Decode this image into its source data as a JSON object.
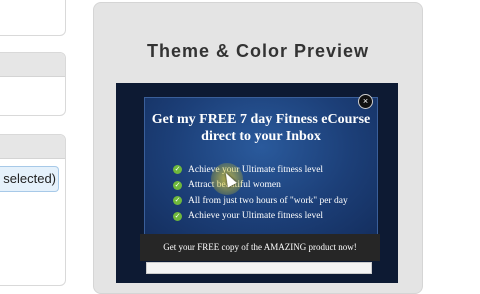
{
  "settings": {
    "selected_option_text": "selected)"
  },
  "preview": {
    "title": "Theme & Color Preview",
    "optin": {
      "headline": "Get my FREE 7 day Fitness eCourse direct to your Inbox",
      "bullets": [
        "Achieve your Ultimate fitness level",
        "Attract beautiful women",
        "All from just two hours of \"work\" per day",
        "Achieve your Ultimate fitness level"
      ],
      "cta_text": "Get your FREE copy of the AMAZING product now!",
      "close_symbol": "×"
    }
  },
  "colors": {
    "optin_background": "#1c3f78",
    "check": "#6fb83c",
    "cta_bar": "#262626"
  },
  "icons": [
    "check-icon",
    "close-icon",
    "mouse-cursor-icon"
  ]
}
